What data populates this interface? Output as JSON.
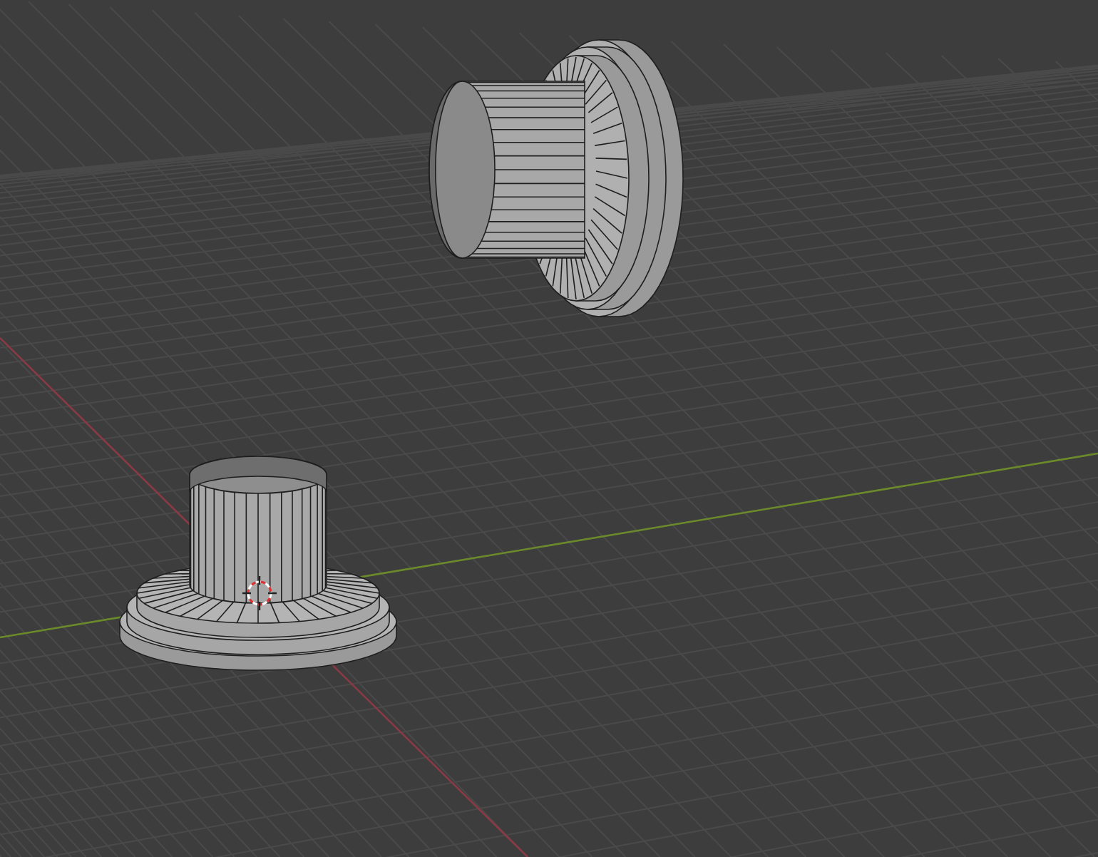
{
  "viewport": {
    "show_grid": true,
    "show_cursor": true
  }
}
